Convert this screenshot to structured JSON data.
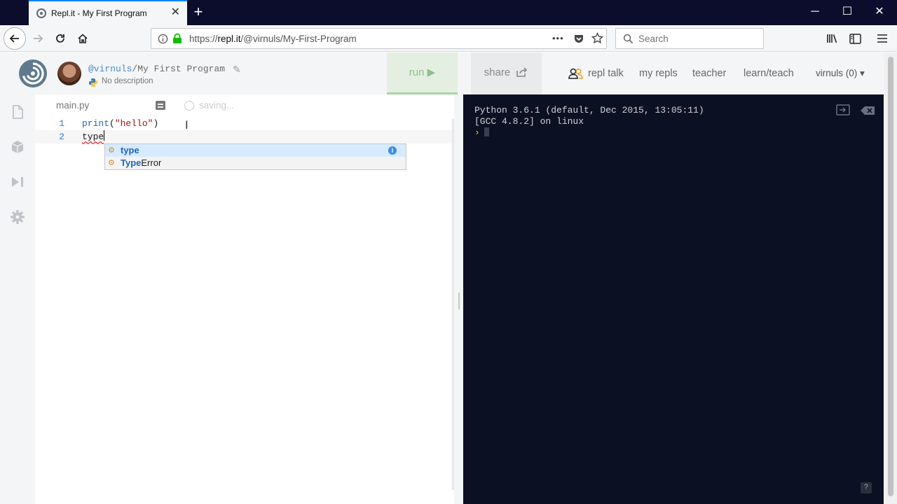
{
  "browser": {
    "tab_title": "Repl.it - My First Program",
    "tab_close": "✕",
    "new_tab": "+",
    "window_controls": {
      "minimize": "─",
      "maximize": "☐",
      "close": "✕"
    },
    "url": {
      "prefix": "https://",
      "domain": "repl.it",
      "path": "/@virnuls/My-First-Program"
    },
    "url_dots": "•••",
    "search_placeholder": "Search"
  },
  "header": {
    "user": "@virnuls",
    "separator": "/",
    "project_name": "My First Program",
    "description": "No description",
    "run_label": "run ▶",
    "share_label": "share",
    "nav": {
      "repl_talk": "repl talk",
      "my_repls": "my repls",
      "teacher": "teacher",
      "learn_teach": "learn/teach",
      "user_menu": "virnuls (0) ▾"
    }
  },
  "editor": {
    "file_tab": "main.py",
    "saving": "saving...",
    "lines": [
      {
        "num": "1",
        "fn": "print",
        "open": "(",
        "str": "\"hello\"",
        "close": ")"
      },
      {
        "num": "2",
        "text": "type"
      }
    ],
    "suggestions": [
      {
        "match": "type",
        "rest": "",
        "icon": "method-icon"
      },
      {
        "match": "Type",
        "rest": "Error",
        "icon": "method-icon"
      }
    ],
    "info_glyph": "i"
  },
  "console": {
    "lines": [
      "Python 3.6.1 (default, Dec 2015, 13:05:11)",
      "[GCC 4.8.2] on linux"
    ],
    "prompt": "›",
    "help": "?"
  },
  "colors": {
    "titlebar": "#0c0c2c",
    "console_bg": "#0b1122",
    "run_green": "#a9d6a4",
    "accent_blue": "#0a84ff"
  }
}
